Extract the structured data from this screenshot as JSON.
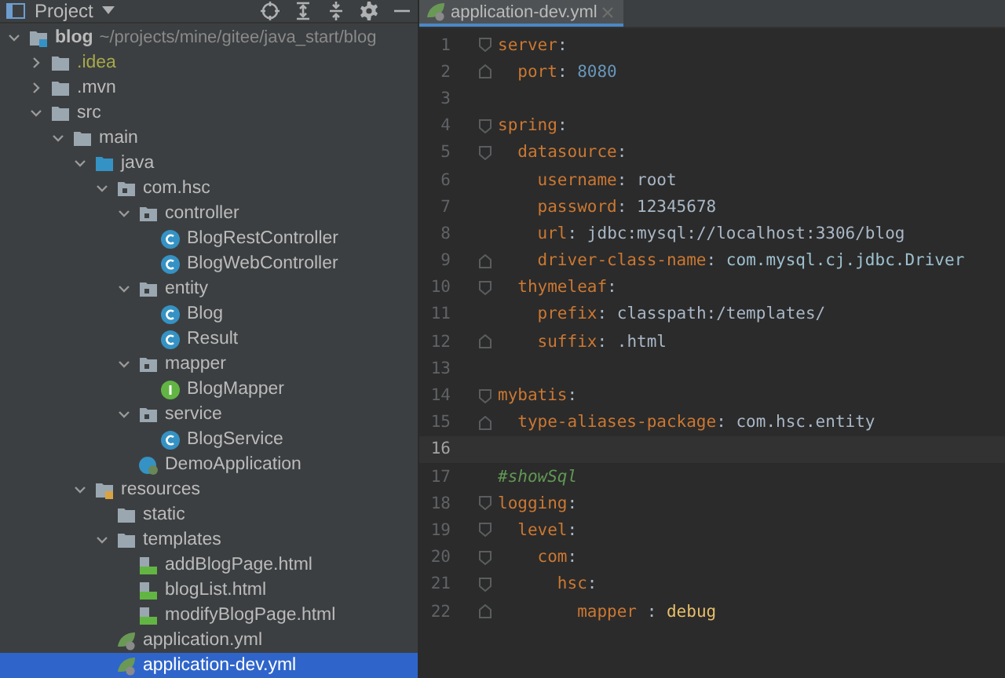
{
  "project_panel": {
    "title": "Project",
    "tools": [
      {
        "kind": "locate"
      },
      {
        "kind": "expand-all"
      },
      {
        "kind": "collapse-all"
      },
      {
        "kind": "settings"
      },
      {
        "kind": "hide"
      }
    ]
  },
  "tree": [
    {
      "name": "blog",
      "path": "~/projects/mine/gitee/java_start/blog",
      "kind": "module",
      "expanded": true,
      "selected": false,
      "children": [
        {
          "name": ".idea",
          "kind": "excluded-folder",
          "expanded": false,
          "selected": false
        },
        {
          "name": ".mvn",
          "kind": "folder",
          "expanded": false,
          "selected": false
        },
        {
          "name": "src",
          "kind": "folder",
          "expanded": true,
          "selected": false,
          "children": [
            {
              "name": "main",
              "kind": "folder",
              "expanded": true,
              "selected": false,
              "children": [
                {
                  "name": "java",
                  "kind": "source-folder",
                  "expanded": true,
                  "selected": false,
                  "children": [
                    {
                      "name": "com.hsc",
                      "kind": "package",
                      "expanded": true,
                      "selected": false,
                      "children": [
                        {
                          "name": "controller",
                          "kind": "package",
                          "expanded": true,
                          "selected": false,
                          "children": [
                            {
                              "name": "BlogRestController",
                              "kind": "class",
                              "selected": false
                            },
                            {
                              "name": "BlogWebController",
                              "kind": "class",
                              "selected": false
                            }
                          ]
                        },
                        {
                          "name": "entity",
                          "kind": "package",
                          "expanded": true,
                          "selected": false,
                          "children": [
                            {
                              "name": "Blog",
                              "kind": "class",
                              "selected": false
                            },
                            {
                              "name": "Result",
                              "kind": "class",
                              "selected": false
                            }
                          ]
                        },
                        {
                          "name": "mapper",
                          "kind": "package",
                          "expanded": true,
                          "selected": false,
                          "children": [
                            {
                              "name": "BlogMapper",
                              "kind": "interface",
                              "selected": false
                            }
                          ]
                        },
                        {
                          "name": "service",
                          "kind": "package",
                          "expanded": true,
                          "selected": false,
                          "children": [
                            {
                              "name": "BlogService",
                              "kind": "class",
                              "selected": false
                            }
                          ]
                        },
                        {
                          "name": "DemoApplication",
                          "kind": "spring-class",
                          "selected": false
                        }
                      ]
                    }
                  ]
                },
                {
                  "name": "resources",
                  "kind": "resources-folder",
                  "expanded": true,
                  "selected": false,
                  "children": [
                    {
                      "name": "static",
                      "kind": "folder",
                      "selected": false
                    },
                    {
                      "name": "templates",
                      "kind": "folder",
                      "expanded": true,
                      "selected": false,
                      "children": [
                        {
                          "name": "addBlogPage.html",
                          "kind": "html",
                          "selected": false
                        },
                        {
                          "name": "blogList.html",
                          "kind": "html",
                          "selected": false
                        },
                        {
                          "name": "modifyBlogPage.html",
                          "kind": "html",
                          "selected": false
                        }
                      ]
                    },
                    {
                      "name": "application.yml",
                      "kind": "yml",
                      "selected": false
                    },
                    {
                      "name": "application-dev.yml",
                      "kind": "yml",
                      "selected": true
                    }
                  ]
                }
              ]
            }
          ]
        }
      ]
    }
  ],
  "editor_tabs": [
    {
      "label": "application-dev.yml",
      "selected": true
    }
  ],
  "lines": [
    {
      "number": "1",
      "current": false,
      "kind": "fold-start",
      "tokens": [
        {
          "kind": "key",
          "text": "server"
        },
        {
          "kind": "punct",
          "text": ":"
        }
      ]
    },
    {
      "number": "2",
      "current": false,
      "kind": "fold-end",
      "tokens": [
        {
          "kind": "key",
          "text": "  port"
        },
        {
          "kind": "punct",
          "text": ": "
        },
        {
          "kind": "number",
          "text": "8080"
        }
      ]
    },
    {
      "number": "3",
      "current": false,
      "kind": "plain"
    },
    {
      "number": "4",
      "current": false,
      "kind": "fold-start",
      "tokens": [
        {
          "kind": "key",
          "text": "spring"
        },
        {
          "kind": "punct",
          "text": ":"
        }
      ]
    },
    {
      "number": "5",
      "current": false,
      "kind": "fold-start",
      "tokens": [
        {
          "kind": "key",
          "text": "  datasource"
        },
        {
          "kind": "punct",
          "text": ":"
        }
      ]
    },
    {
      "number": "6",
      "current": false,
      "kind": "plain",
      "tokens": [
        {
          "kind": "key",
          "text": "    username"
        },
        {
          "kind": "punct",
          "text": ": "
        },
        {
          "kind": "value",
          "text": "root"
        }
      ]
    },
    {
      "number": "7",
      "current": false,
      "kind": "plain",
      "tokens": [
        {
          "kind": "key",
          "text": "    password"
        },
        {
          "kind": "punct",
          "text": ": "
        },
        {
          "kind": "value",
          "text": "12345678"
        }
      ]
    },
    {
      "number": "8",
      "current": false,
      "kind": "plain",
      "tokens": [
        {
          "kind": "key",
          "text": "    url"
        },
        {
          "kind": "punct",
          "text": ": "
        },
        {
          "kind": "value",
          "text": "jdbc:mysql://localhost:3306/blog"
        }
      ]
    },
    {
      "number": "9",
      "current": false,
      "kind": "fold-end",
      "tokens": [
        {
          "kind": "key",
          "text": "    driver-class-name"
        },
        {
          "kind": "punct",
          "text": ": "
        },
        {
          "kind": "class",
          "text": "com.mysql.cj.jdbc.Driver"
        }
      ]
    },
    {
      "number": "10",
      "current": false,
      "kind": "fold-start",
      "tokens": [
        {
          "kind": "key",
          "text": "  thymeleaf"
        },
        {
          "kind": "punct",
          "text": ":"
        }
      ]
    },
    {
      "number": "11",
      "current": false,
      "kind": "plain",
      "tokens": [
        {
          "kind": "key",
          "text": "    prefix"
        },
        {
          "kind": "punct",
          "text": ": "
        },
        {
          "kind": "value",
          "text": "classpath:/templates/"
        }
      ]
    },
    {
      "number": "12",
      "current": false,
      "kind": "fold-end",
      "tokens": [
        {
          "kind": "key",
          "text": "    suffix"
        },
        {
          "kind": "punct",
          "text": ": "
        },
        {
          "kind": "value",
          "text": ".html"
        }
      ]
    },
    {
      "number": "13",
      "current": false,
      "kind": "plain"
    },
    {
      "number": "14",
      "current": false,
      "kind": "fold-start",
      "tokens": [
        {
          "kind": "key",
          "text": "mybatis"
        },
        {
          "kind": "punct",
          "text": ":"
        }
      ]
    },
    {
      "number": "15",
      "current": false,
      "kind": "fold-end",
      "tokens": [
        {
          "kind": "key",
          "text": "  type-aliases-package"
        },
        {
          "kind": "punct",
          "text": ": "
        },
        {
          "kind": "value",
          "text": "com.hsc.entity"
        }
      ]
    },
    {
      "number": "16",
      "current": true,
      "kind": "plain"
    },
    {
      "number": "17",
      "current": false,
      "kind": "plain",
      "tokens": [
        {
          "kind": "comment",
          "text": "#showSql"
        }
      ]
    },
    {
      "number": "18",
      "current": false,
      "kind": "fold-start",
      "tokens": [
        {
          "kind": "key",
          "text": "logging"
        },
        {
          "kind": "punct",
          "text": ":"
        }
      ]
    },
    {
      "number": "19",
      "current": false,
      "kind": "fold-start",
      "tokens": [
        {
          "kind": "key",
          "text": "  level"
        },
        {
          "kind": "punct",
          "text": ":"
        }
      ]
    },
    {
      "number": "20",
      "current": false,
      "kind": "fold-start",
      "tokens": [
        {
          "kind": "key",
          "text": "    com"
        },
        {
          "kind": "punct",
          "text": ":"
        }
      ]
    },
    {
      "number": "21",
      "current": false,
      "kind": "fold-start",
      "tokens": [
        {
          "kind": "key",
          "text": "      hsc"
        },
        {
          "kind": "punct",
          "text": ":"
        }
      ]
    },
    {
      "number": "22",
      "current": false,
      "kind": "fold-end",
      "tokens": [
        {
          "kind": "key",
          "text": "        mapper "
        },
        {
          "kind": "punct",
          "text": ": "
        },
        {
          "kind": "keyword",
          "text": "debug"
        }
      ]
    }
  ]
}
